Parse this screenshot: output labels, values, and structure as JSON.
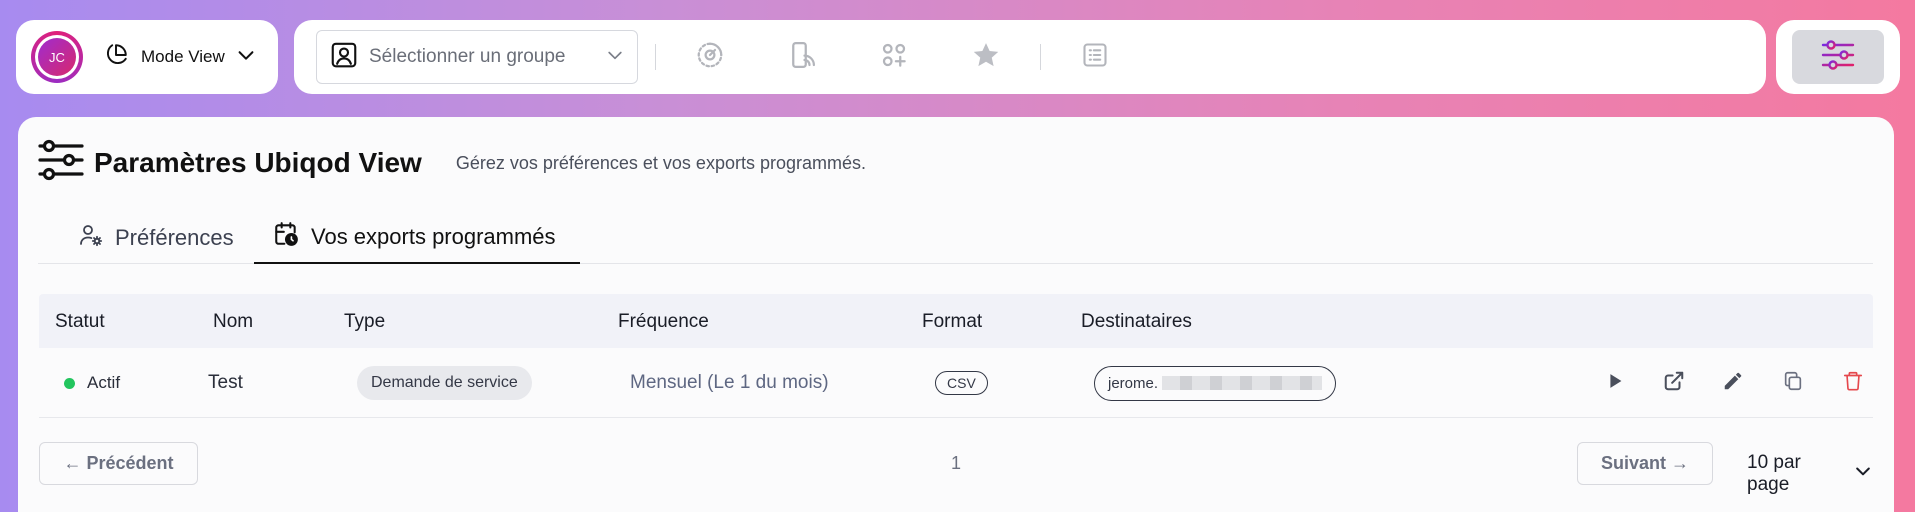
{
  "user": {
    "initials": "JC"
  },
  "mode": {
    "label": "Mode View"
  },
  "toolbar": {
    "group_placeholder": "Sélectionner un groupe"
  },
  "page": {
    "title": "Paramètres Ubiqod View",
    "subtitle": "Gérez vos préférences et vos exports programmés."
  },
  "tabs": [
    {
      "label": "Préférences",
      "active": false
    },
    {
      "label": "Vos exports programmés",
      "active": true
    }
  ],
  "table": {
    "headers": [
      "Statut",
      "Nom",
      "Type",
      "Fréquence",
      "Format",
      "Destinataires"
    ],
    "rows": [
      {
        "status": "Actif",
        "status_color": "#22c55e",
        "name": "Test",
        "type": "Demande de service",
        "frequency": "Mensuel (Le 1 du mois)",
        "format": "CSV",
        "recipients": "jerome."
      }
    ]
  },
  "pagination": {
    "prev_label": "← Précédent",
    "page": "1",
    "next_label": "Suivant →",
    "per_page": "10 par page"
  },
  "colors": {
    "accent": "#9b2cc2",
    "status_active": "#22c55e",
    "delete": "#e5484d"
  }
}
